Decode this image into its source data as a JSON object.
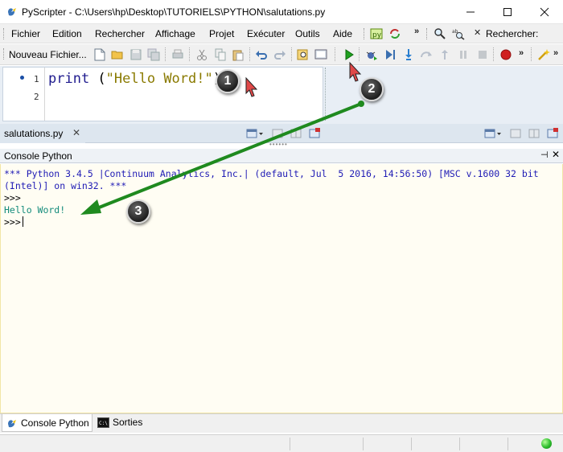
{
  "window": {
    "title": "PyScripter - C:\\Users\\hp\\Desktop\\TUTORIELS\\PYTHON\\salutations.py",
    "minimize": "—",
    "maximize": "☐",
    "close": "✕"
  },
  "menu": {
    "items": [
      "Fichier",
      "Edition",
      "Rechercher",
      "Affichage",
      "Projet",
      "Exécuter",
      "Outils",
      "Aide"
    ],
    "search_label": "Rechercher:"
  },
  "toolbar": {
    "new_file_label": "Nouveau Fichier..."
  },
  "editor": {
    "line_numbers": [
      "1",
      "2"
    ],
    "code": {
      "keyword": "print",
      "open": " (",
      "string": "\"Hello Word!\"",
      "close": ")"
    }
  },
  "file_tab": {
    "name": "salutations.py",
    "close": "✕"
  },
  "console": {
    "title": "Console Python",
    "pin": "⊣",
    "close": "✕",
    "lines": {
      "info1": "*** Python 3.4.5 |Continuum Analytics, Inc.| (default, Jul  5 2016, 14:56:50) [MSC v.1600 32 bit",
      "info2": "(Intel)] on win32. ***",
      "prompt1": ">>>",
      "output": "Hello Word!",
      "prompt2": ">>>"
    }
  },
  "bottom_tabs": {
    "console": "Console Python",
    "outputs": "Sorties"
  },
  "annotations": {
    "step1": "1",
    "step2": "2",
    "step3": "3",
    "arrow_color": "#1f8a1f",
    "cursor_color": "#e04040"
  },
  "colors": {
    "keyword": "#1f1b8e",
    "string": "#8a7a00",
    "console_info": "#1f1bb5",
    "console_output": "#138b7b",
    "status_ok": "#2dbd2d"
  }
}
